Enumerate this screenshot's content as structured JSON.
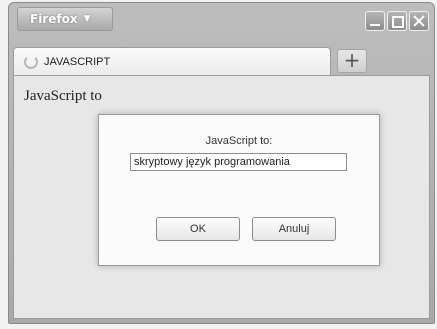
{
  "window": {
    "app_menu_label": "Firefox",
    "tab_label": "JAVASCRIPT",
    "new_tab_symbol": "+"
  },
  "page": {
    "text": "JavaScript to"
  },
  "dialog": {
    "message": "JavaScript to:",
    "input_value": "skryptowy język programowania",
    "ok_label": "OK",
    "cancel_label": "Anuluj"
  }
}
